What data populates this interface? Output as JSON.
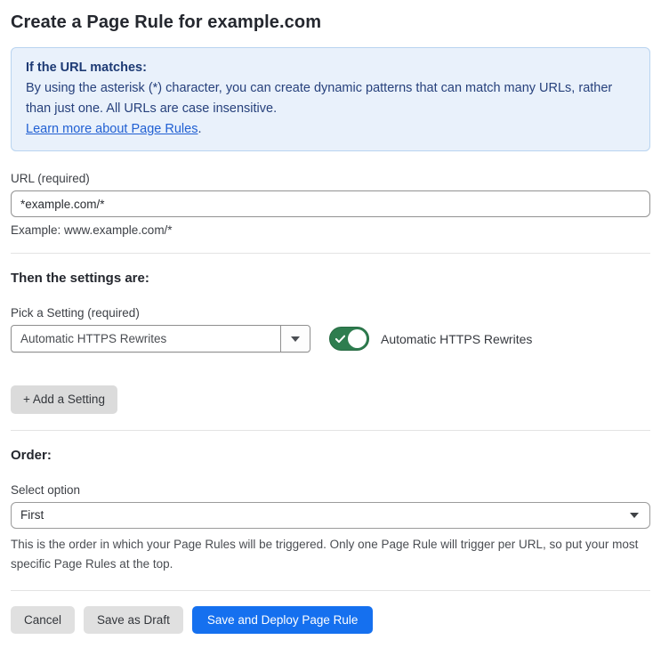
{
  "page": {
    "title": "Create a Page Rule for example.com"
  },
  "info_box": {
    "heading": "If the URL matches:",
    "body": "By using the asterisk (*) character, you can create dynamic patterns that can match many URLs, rather than just one. All URLs are case insensitive.",
    "link_label": "Learn more about Page Rules",
    "link_suffix": "."
  },
  "url_field": {
    "label": "URL (required)",
    "value": "*example.com/*",
    "hint": "Example: www.example.com/*"
  },
  "settings_section": {
    "heading": "Then the settings are:",
    "picker_label": "Pick a Setting (required)",
    "picker_value": "Automatic HTTPS Rewrites",
    "toggle_label": "Automatic HTTPS Rewrites",
    "toggle_state": "on",
    "add_setting_label": "+ Add a Setting"
  },
  "order_section": {
    "heading": "Order:",
    "select_label": "Select option",
    "select_value": "First",
    "help_text": "This is the order in which your Page Rules will be triggered. Only one Page Rule will trigger per URL, so put your most specific Page Rules at the top."
  },
  "footer": {
    "cancel_label": "Cancel",
    "save_draft_label": "Save as Draft",
    "save_deploy_label": "Save and Deploy Page Rule"
  },
  "colors": {
    "primary_blue": "#1570ef",
    "toggle_green": "#2e7d4f",
    "info_background": "#e9f1fb",
    "info_border": "#b9d4f0",
    "info_text": "#27417c",
    "link_blue": "#2160d3"
  }
}
